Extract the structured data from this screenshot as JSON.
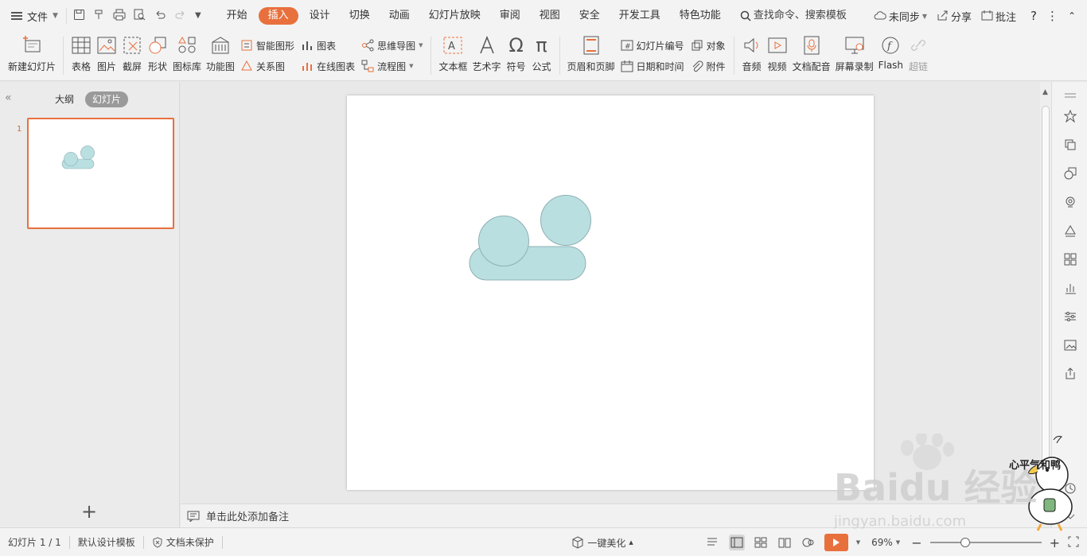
{
  "topbar": {
    "file_label": "文件",
    "tabs": [
      "开始",
      "插入",
      "设计",
      "切换",
      "动画",
      "幻灯片放映",
      "审阅",
      "视图",
      "安全",
      "开发工具",
      "特色功能"
    ],
    "active_tab": "插入",
    "search_label": "查找命令、搜索模板",
    "sync_label": "未同步",
    "share_label": "分享",
    "comment_label": "批注",
    "help_label": "?"
  },
  "ribbon": {
    "new_slide": "新建幻灯片",
    "table": "表格",
    "picture": "图片",
    "screenshot": "截屏",
    "shape": "形状",
    "icon_lib": "图标库",
    "function_chart": "功能图",
    "smart_art": "智能图形",
    "relation_chart": "关系图",
    "chart": "图表",
    "online_chart": "在线图表",
    "mind_map": "思维导图",
    "flowchart": "流程图",
    "text_box": "文本框",
    "art_text": "艺术字",
    "symbol": "符号",
    "formula": "公式",
    "header_footer": "页眉和页脚",
    "slide_number": "幻灯片编号",
    "date_time": "日期和时间",
    "object": "对象",
    "attachment": "附件",
    "audio": "音频",
    "video": "视频",
    "doc_dub": "文档配音",
    "screen_record": "屏幕录制",
    "flash": "Flash",
    "hyperlink": "超链"
  },
  "left_panel": {
    "outline_tab": "大纲",
    "slides_tab": "幻灯片",
    "slide_number": "1"
  },
  "notes": {
    "placeholder": "单击此处添加备注"
  },
  "statusbar": {
    "slide_count": "幻灯片 1 / 1",
    "template": "默认设计模板",
    "protection": "文档未保护",
    "beautify": "一键美化",
    "zoom": "69%"
  },
  "slide_shapes": {
    "fill": "#b9dfe1",
    "stroke": "#8fb0b3"
  },
  "watermark": {
    "baidu_text": "Baidu 经验",
    "baidu_url": "jingyan.baidu.com",
    "mascot_text": "心平气和鸭"
  },
  "colors": {
    "accent": "#e8703d"
  }
}
